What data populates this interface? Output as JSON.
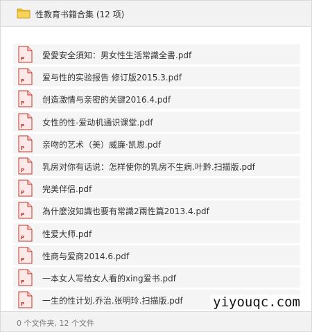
{
  "header": {
    "folder_icon": "folder-icon",
    "title": "性教育书籍合集 (12 项)"
  },
  "files": [
    {
      "name": "愛愛安全須知：男女性生活常識全書.pdf",
      "icon": "pdf-file-icon"
    },
    {
      "name": "爱与性的实验报告 修订版2015.3.pdf",
      "icon": "pdf-file-icon"
    },
    {
      "name": "创造激情与亲密的关键2016.4.pdf",
      "icon": "pdf-file-icon"
    },
    {
      "name": "女性的性-爱动机通识课堂.pdf",
      "icon": "pdf-file-icon"
    },
    {
      "name": "亲吻的艺术（美）威廉·凯恩.pdf",
      "icon": "pdf-file-icon"
    },
    {
      "name": "乳房对你有话说：怎样使你的乳房不生病.叶黔.扫描版.pdf",
      "icon": "pdf-file-icon"
    },
    {
      "name": "完美伴侣.pdf",
      "icon": "pdf-file-icon"
    },
    {
      "name": "為什麼沒知識也要有常識2兩性篇2013.4.pdf",
      "icon": "pdf-file-icon"
    },
    {
      "name": "性爱大师.pdf",
      "icon": "pdf-file-icon"
    },
    {
      "name": "性商与爱商2014.6.pdf",
      "icon": "pdf-file-icon"
    },
    {
      "name": "一本女人写给女人看的xing爱书.pdf",
      "icon": "pdf-file-icon"
    },
    {
      "name": "一生的性计划.乔治.张明玲.扫描版.pdf",
      "icon": "pdf-file-icon"
    }
  ],
  "footer": {
    "summary": "0 个文件夹, 12 个文件"
  },
  "watermark": "yiyouqc.com",
  "colors": {
    "header_bg": "#f2f2f2",
    "row_bg": "#f5f5f5",
    "folder_yellow": "#f4c430",
    "pdf_red": "#c0392b"
  }
}
